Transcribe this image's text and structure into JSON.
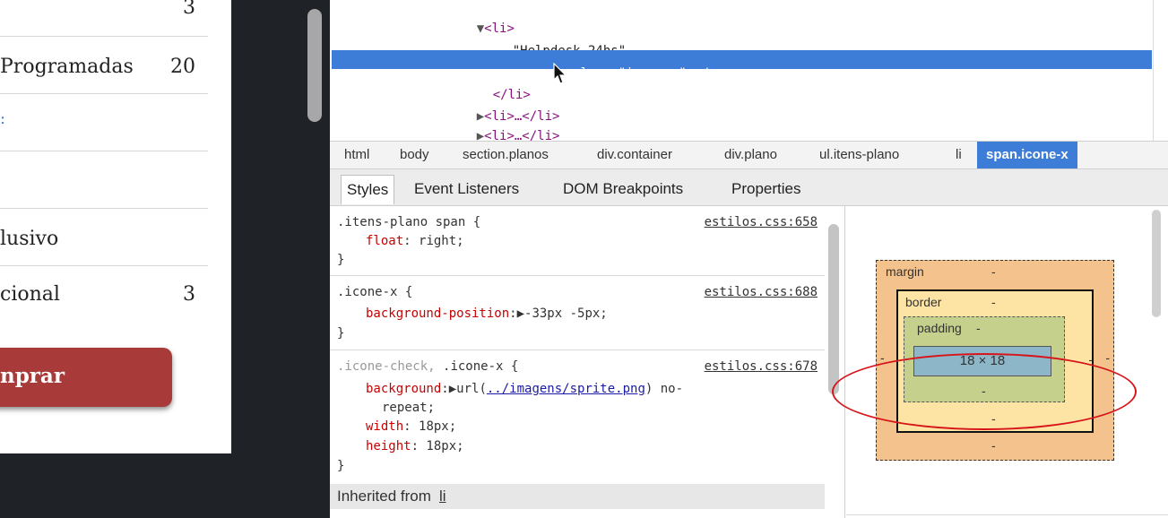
{
  "left_page": {
    "rows": [
      {
        "label": "",
        "count": "3"
      },
      {
        "label": "Programadas",
        "count": "20"
      },
      {
        "label": ":",
        "count": ""
      },
      {
        "label": "",
        "count": ""
      },
      {
        "label": "lusivo",
        "count": ""
      },
      {
        "label": "cional",
        "count": "3"
      }
    ],
    "button_label": "nprar"
  },
  "elements_panel": {
    "lines": [
      {
        "t1": "▼",
        "t2": "<li>"
      },
      {
        "text": "\"Helpdesk 24hs\""
      },
      {
        "open": "<span ",
        "attr": "class",
        "eq": "=\"",
        "val": "icone-x",
        "close": "\"></span>"
      },
      {
        "tag": "</li>"
      },
      {
        "t1": "▶",
        "t2": "<li>…</li>"
      },
      {
        "t1": "▶",
        "t2": "<li>…</li>"
      }
    ]
  },
  "breadcrumb": [
    "html",
    "body",
    "section.planos",
    "div.container",
    "div.plano",
    "ul.itens-plano",
    "li",
    "span.icone-x"
  ],
  "tabs": [
    "Styles",
    "Event Listeners",
    "DOM Breakpoints",
    "Properties"
  ],
  "rules": {
    "rule1": {
      "selector": ".itens-plano span {",
      "source": "estilos.css:658",
      "prop": "float",
      "value": " right;",
      "close": "}"
    },
    "rule2": {
      "selector": ".icone-x {",
      "source": "estilos.css:688",
      "prop": "background-position",
      "value": ":▶-33px -5px;",
      "close": "}"
    },
    "rule3": {
      "selector_dim": ".icone-check, ",
      "selector": ".icone-x {",
      "source": "estilos.css:678",
      "bg_prop": "background",
      "bg_pre": ":▶url(",
      "bg_url": "../imagens/sprite.png",
      "bg_post": ") no-",
      "bg_cont": "repeat;",
      "w_prop": "width",
      "w_val": ": 18px;",
      "h_prop": "height",
      "h_val": ": 18px;",
      "close": "}"
    },
    "inherited_label": "Inherited from ",
    "inherited_link": "li"
  },
  "box_model": {
    "margin_label": "margin",
    "border_label": "border",
    "padding_label": "padding",
    "dash": "-",
    "content": "18 × 18"
  },
  "colors": {
    "selected_row": "#3d7dd8",
    "annotation": "#d7141a"
  }
}
